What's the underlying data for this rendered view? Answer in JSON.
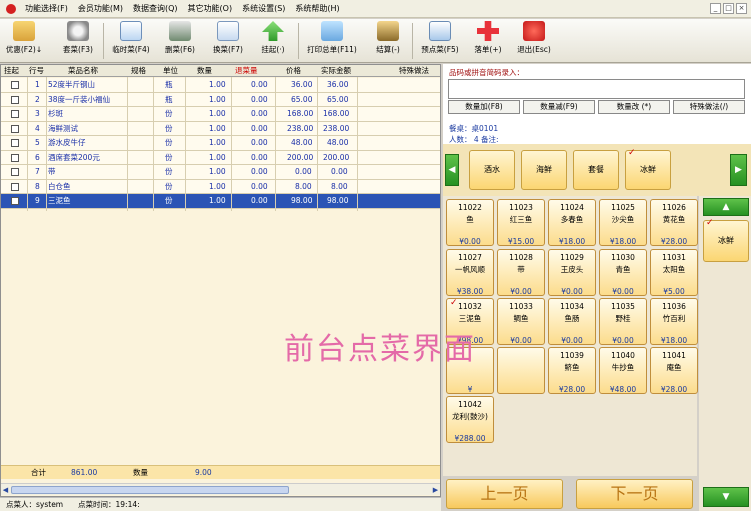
{
  "menubar": {
    "items": [
      "功能选择(F)",
      "会员功能(M)",
      "数据查询(Q)",
      "其它功能(O)",
      "系统设置(S)",
      "系统帮助(H)"
    ],
    "window_controls": [
      "_",
      "□",
      "×"
    ]
  },
  "toolbar": {
    "buttons": [
      {
        "label": "优惠(F2)↓",
        "icon": "folder-discount-icon"
      },
      {
        "label": "套菜(F3)",
        "icon": "gear-set-meal-icon"
      },
      {
        "label": "临时菜(F4)",
        "icon": "temp-dish-icon"
      },
      {
        "label": "删菜(F6)",
        "icon": "printer-delete-icon"
      },
      {
        "label": "换菜(F7)",
        "icon": "swap-dish-icon"
      },
      {
        "label": "挂起(·)",
        "icon": "up-arrow-icon"
      },
      {
        "label": "打印总单(F11)",
        "icon": "print-bill-icon"
      },
      {
        "label": "结算(-)",
        "icon": "settle-icon"
      },
      {
        "label": "预点菜(F5)",
        "icon": "pre-order-icon"
      },
      {
        "label": "落单(+)",
        "icon": "red-cross-icon"
      },
      {
        "label": "退出(Esc)",
        "icon": "power-icon"
      }
    ]
  },
  "order_table": {
    "headers": [
      "挂起",
      "行号",
      "菜品名称",
      "规格",
      "单位",
      "数量",
      "退菜量",
      "价格",
      "实际金额",
      "特殊做法"
    ],
    "rows": [
      {
        "no": "1",
        "name": "52度半斤钢山",
        "unit": "瓶",
        "qty": "1.00",
        "ret": "0.00",
        "price": "36.00",
        "amount": "36.00"
      },
      {
        "no": "2",
        "name": "38度一斤装小福仙",
        "unit": "瓶",
        "qty": "1.00",
        "ret": "0.00",
        "price": "65.00",
        "amount": "65.00"
      },
      {
        "no": "3",
        "name": "杉斑",
        "unit": "份",
        "qty": "1.00",
        "ret": "0.00",
        "price": "168.00",
        "amount": "168.00"
      },
      {
        "no": "4",
        "name": "海鲜测试",
        "unit": "份",
        "qty": "1.00",
        "ret": "0.00",
        "price": "238.00",
        "amount": "238.00"
      },
      {
        "no": "5",
        "name": "游水皮牛仔",
        "unit": "份",
        "qty": "1.00",
        "ret": "0.00",
        "price": "48.00",
        "amount": "48.00"
      },
      {
        "no": "6",
        "name": "酒席套菜200元",
        "unit": "份",
        "qty": "1.00",
        "ret": "0.00",
        "price": "200.00",
        "amount": "200.00"
      },
      {
        "no": "7",
        "name": "带",
        "unit": "份",
        "qty": "1.00",
        "ret": "0.00",
        "price": "0.00",
        "amount": "0.00"
      },
      {
        "no": "8",
        "name": "白仓鱼",
        "unit": "份",
        "qty": "1.00",
        "ret": "0.00",
        "price": "8.00",
        "amount": "8.00"
      },
      {
        "no": "9",
        "name": "三泥鱼",
        "unit": "份",
        "qty": "1.00",
        "ret": "0.00",
        "price": "98.00",
        "amount": "98.00"
      }
    ],
    "total_label": "合计",
    "total_value": "861.00",
    "qty_label": "数量",
    "qty_value": "9.00"
  },
  "status": {
    "operator": "点菜人：system",
    "time": "点菜时间：19:14:"
  },
  "right_top": {
    "input_label": "品码或拼音简码录入：",
    "buttons": [
      "数量加(F8)",
      "数量减(F9)",
      "数量改 (*)",
      "特殊做法(/)"
    ],
    "table_info": "餐桌：桌0101",
    "guest_info": "人数： 4  备注:"
  },
  "categories": [
    {
      "label": "酒水",
      "checked": false
    },
    {
      "label": "海鲜",
      "checked": false
    },
    {
      "label": "套餐",
      "checked": false
    },
    {
      "label": "冰鲜",
      "checked": true
    }
  ],
  "dishes": [
    {
      "code": "11022",
      "name": "鱼",
      "price": "¥0.00"
    },
    {
      "code": "11023",
      "name": "红三鱼",
      "price": "¥15.00"
    },
    {
      "code": "11024",
      "name": "多春鱼",
      "price": "¥18.00"
    },
    {
      "code": "11025",
      "name": "沙尖鱼",
      "price": "¥18.00"
    },
    {
      "code": "11026",
      "name": "黄花鱼",
      "price": "¥28.00"
    },
    {
      "code": "11027",
      "name": "一帆风顺",
      "price": "¥38.00"
    },
    {
      "code": "11028",
      "name": "带",
      "price": "¥0.00"
    },
    {
      "code": "11029",
      "name": "王皮头",
      "price": "¥0.00"
    },
    {
      "code": "11030",
      "name": "青鱼",
      "price": "¥0.00"
    },
    {
      "code": "11031",
      "name": "太阳鱼",
      "price": "¥5.00"
    },
    {
      "code": "11032",
      "name": "三泥鱼",
      "price": "¥98.00",
      "checked": true
    },
    {
      "code": "11033",
      "name": "鲷鱼",
      "price": "¥0.00"
    },
    {
      "code": "11034",
      "name": "鱼肠",
      "price": "¥0.00"
    },
    {
      "code": "11035",
      "name": "野桂",
      "price": "¥0.00"
    },
    {
      "code": "11036",
      "name": "竹百利",
      "price": "¥18.00"
    },
    {
      "code": "",
      "name": "",
      "price": "¥"
    },
    {
      "code": "",
      "name": "",
      "price": ""
    },
    {
      "code": "11039",
      "name": "鲚鱼",
      "price": "¥28.00"
    },
    {
      "code": "11040",
      "name": "牛抄鱼",
      "price": "¥48.00"
    },
    {
      "code": "11041",
      "name": "庵鱼",
      "price": "¥28.00"
    },
    {
      "code": "11042",
      "name": "龙利(鼓沙)",
      "price": "¥288.00"
    }
  ],
  "paging": {
    "prev": "上一页",
    "next": "下一页",
    "side_category": "冰鲜"
  },
  "caption": "前台点菜界面",
  "colors": {
    "selected_row": "#2b54b5",
    "accent_green": "#269122",
    "tile": "#fcdc8c"
  }
}
